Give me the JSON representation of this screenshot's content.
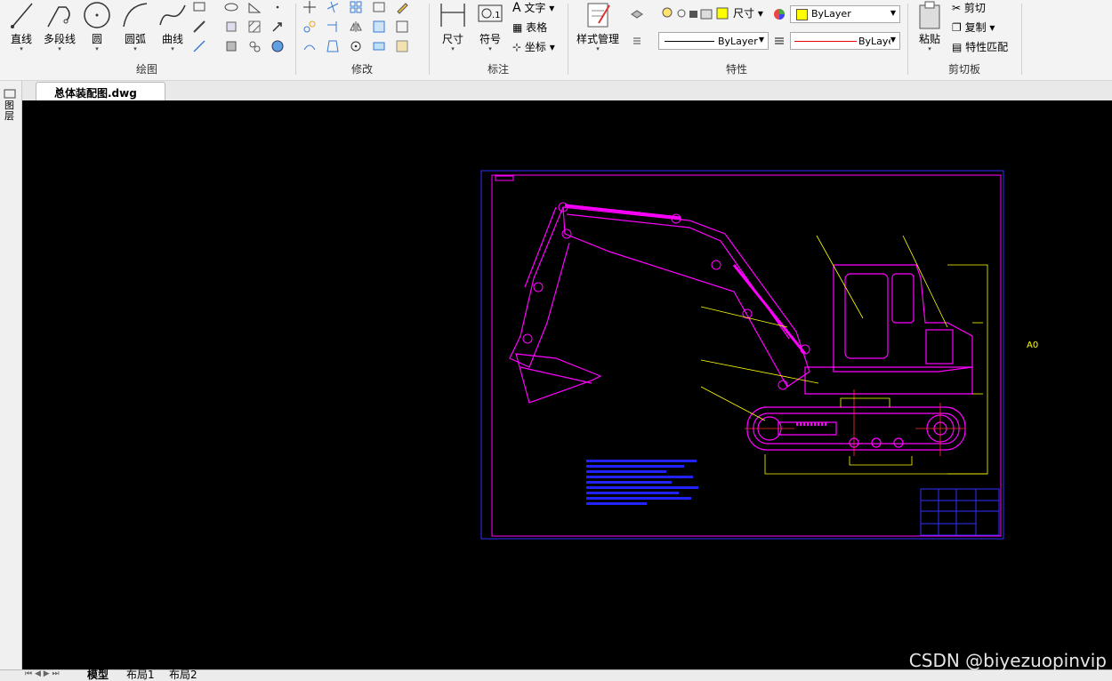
{
  "file_tab": {
    "name": "总体装配图.dwg",
    "close": "×"
  },
  "ribbon": {
    "draw": {
      "label": "绘图",
      "line": "直线",
      "polyline": "多段线",
      "circle": "圆",
      "arc": "圆弧",
      "curve": "曲线"
    },
    "modify": {
      "label": "修改"
    },
    "annotate": {
      "label": "标注",
      "dimension": "尺寸",
      "symbol": "符号",
      "text": "文字",
      "table": "表格",
      "coordinate": "坐标"
    },
    "properties": {
      "label": "特性",
      "style_manager": "样式管理",
      "size_label": "尺寸",
      "color_value": "ByLayer",
      "linetype_value": "ByLayer",
      "lineweight_value": "ByLayer"
    },
    "clipboard": {
      "label": "剪切板",
      "paste": "粘贴",
      "cut": "剪切",
      "copy": "复制",
      "match": "特性匹配"
    }
  },
  "sidebar": {
    "label": "图层"
  },
  "canvas": {
    "sheet_label": "A0"
  },
  "layout_tabs": [
    "模型",
    "布局1",
    "布局2"
  ],
  "watermark": "CSDN @biyezuopinvip",
  "colors": {
    "canvas": "#000000",
    "drawing": "#ff00ff",
    "dimension": "#ffff00",
    "frame": "#3030ff",
    "note": "#2222ff"
  }
}
